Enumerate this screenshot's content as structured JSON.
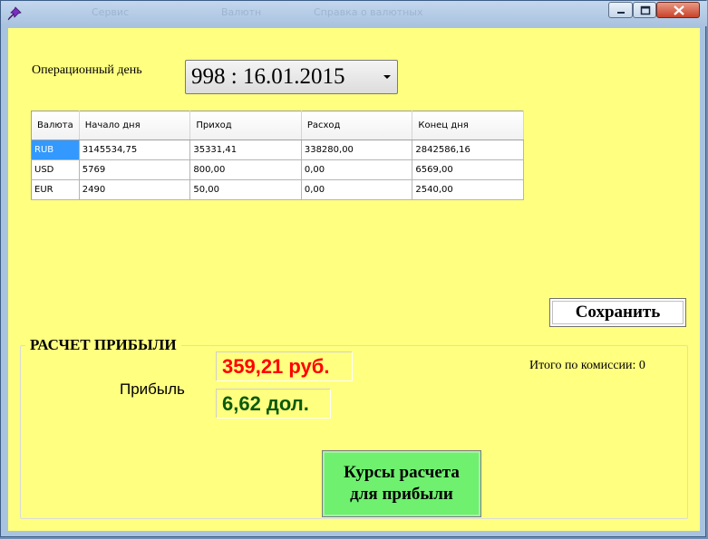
{
  "window": {
    "app_icon": "pin-icon",
    "background_titles": [
      "Сервис",
      "Валютн",
      "Справка о валютных"
    ],
    "controls": {
      "minimize": "minimize-icon",
      "maximize": "maximize-icon",
      "close": "close-icon"
    }
  },
  "operational_day": {
    "label": "Операционный день",
    "value": "998 : 16.01.2015"
  },
  "grid": {
    "columns": [
      "Валюта",
      "Начало дня",
      "Приход",
      "Расход",
      "Конец дня"
    ],
    "rows": [
      [
        "RUB",
        "3145534,75",
        "35331,41",
        "338280,00",
        "2842586,16"
      ],
      [
        "USD",
        "5769",
        "800,00",
        "0,00",
        "6569,00"
      ],
      [
        "EUR",
        "2490",
        "50,00",
        "0,00",
        "2540,00"
      ]
    ],
    "selected_cell": "RUB"
  },
  "save_button": "Сохранить",
  "profit": {
    "group_title": "РАСЧЕТ ПРИБЫЛИ",
    "label": "Прибыль",
    "rub_value": "359,21 руб.",
    "usd_value": "6,62 дол.",
    "commission": "Итого по комиссии: 0",
    "rates_button_line1": "Курсы расчета",
    "rates_button_line2": "для прибыли"
  },
  "colors": {
    "client_background": "#ffff80",
    "rub_value": "#ff0000",
    "usd_value": "#0b5a0b",
    "rates_button": "#6ff06f",
    "selection": "#3399ff"
  }
}
